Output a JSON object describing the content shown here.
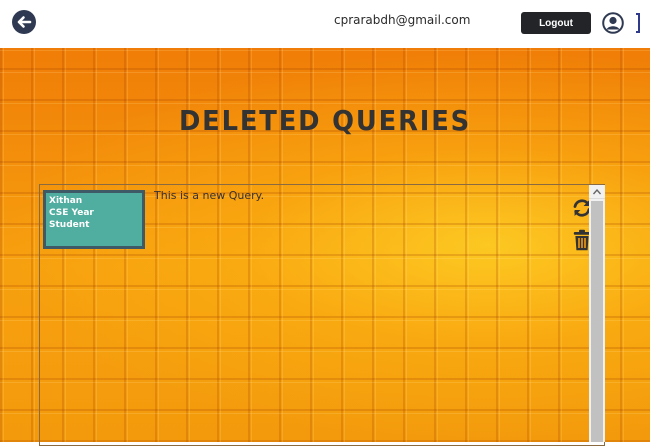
{
  "header": {
    "email": "cprarabdh@gmail.com",
    "logout_label": "Logout",
    "back_icon": "arrow-left-circle",
    "avatar_icon": "user-circle"
  },
  "main": {
    "title": "Deleted Queries",
    "queries": [
      {
        "user": {
          "name": "Xithan",
          "branch_year": "CSE Year",
          "role": "Student"
        },
        "text": "This is a new Query.",
        "actions": [
          "restore-icon",
          "trash-icon"
        ]
      }
    ]
  },
  "colors": {
    "header_bg": "#ffffff",
    "logout_bg": "#222428",
    "card_bg": "#4fae9f",
    "card_border": "#3d5a66",
    "background_orange": "#f39a0c",
    "title_text": "#333333"
  }
}
